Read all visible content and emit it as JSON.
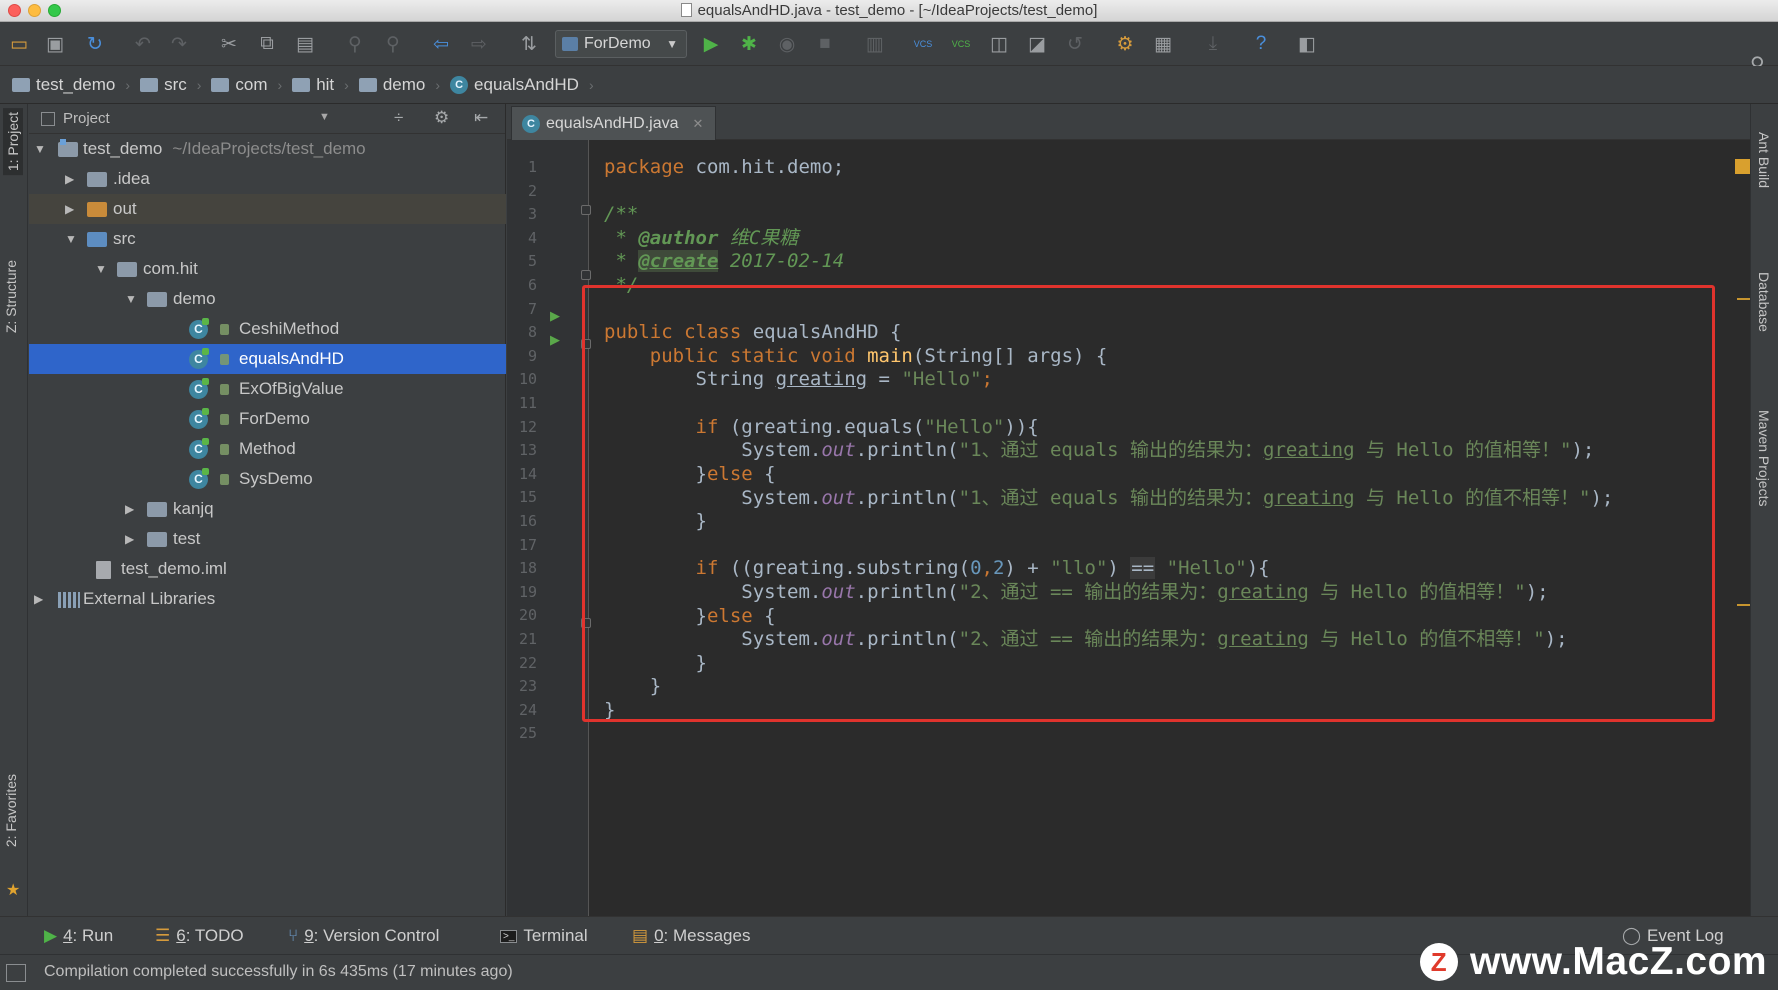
{
  "window": {
    "title": "equalsAndHD.java - test_demo - [~/IdeaProjects/test_demo]"
  },
  "toolbar": {
    "run_config": "ForDemo",
    "icons": [
      "open-folder-icon",
      "save-icon",
      "sync-icon",
      "undo-icon",
      "redo-icon",
      "cut-icon",
      "copy-icon",
      "paste-icon",
      "find-icon",
      "replace-icon",
      "back-icon",
      "forward-icon",
      "make-project-icon",
      "run-icon",
      "debug-icon",
      "coverage-icon",
      "stop-icon",
      "vcs-update-icon",
      "vcs-commit-icon",
      "vcs-history-icon",
      "project-structure-icon",
      "settings-icon",
      "help-icon",
      "search-icon"
    ],
    "vcs_label": "VCS",
    "help_label": "?"
  },
  "breadcrumb": [
    "test_demo",
    "src",
    "com",
    "hit",
    "demo",
    "equalsAndHD"
  ],
  "left_tabs": {
    "project": "1: Project",
    "structure": "Z: Structure",
    "favorites": "2: Favorites"
  },
  "right_tabs": {
    "ant": "Ant Build",
    "database": "Database",
    "maven": "Maven Projects"
  },
  "project_panel": {
    "title": "Project",
    "tree": [
      {
        "label": "test_demo",
        "path": "~/IdeaProjects/test_demo",
        "depth": 0,
        "kind": "module",
        "expanded": true
      },
      {
        "label": ".idea",
        "depth": 1,
        "kind": "folder",
        "expanded": false
      },
      {
        "label": "out",
        "depth": 1,
        "kind": "folder-orange",
        "expanded": false
      },
      {
        "label": "src",
        "depth": 1,
        "kind": "folder-blue",
        "expanded": true
      },
      {
        "label": "com.hit",
        "depth": 2,
        "kind": "package",
        "expanded": true
      },
      {
        "label": "demo",
        "depth": 3,
        "kind": "package",
        "expanded": true
      },
      {
        "label": "CeshiMethod",
        "depth": 4,
        "kind": "class"
      },
      {
        "label": "equalsAndHD",
        "depth": 4,
        "kind": "class",
        "selected": true
      },
      {
        "label": "ExOfBigValue",
        "depth": 4,
        "kind": "class"
      },
      {
        "label": "ForDemo",
        "depth": 4,
        "kind": "class"
      },
      {
        "label": "Method",
        "depth": 4,
        "kind": "class"
      },
      {
        "label": "SysDemo",
        "depth": 4,
        "kind": "class"
      },
      {
        "label": "kanjq",
        "depth": 3,
        "kind": "package",
        "expanded": false
      },
      {
        "label": "test",
        "depth": 3,
        "kind": "package",
        "expanded": false
      },
      {
        "label": "test_demo.iml",
        "depth": 2,
        "kind": "file"
      },
      {
        "label": "External Libraries",
        "depth": 0,
        "kind": "libs",
        "expanded": false
      }
    ]
  },
  "editor": {
    "tab_label": "equalsAndHD.java",
    "line_count": 25,
    "lines": {
      "l1_kw": "package",
      "l1_rest": " com.hit.demo;",
      "l3": "/**",
      "l4_star": " * ",
      "l4_tag": "@author",
      "l4_val": " 维C果糖",
      "l5_star": " * ",
      "l5_tag": "@create",
      "l5_val": " 2017-02-14",
      "l6": " */",
      "l8_kw": "public class",
      "l8_rest": " equalsAndHD {",
      "l9_kw": "    public static void",
      "l9_fn": " main",
      "l9_rest": "(String[] args) {",
      "l10_a": "        String ",
      "l10_var": "greating",
      "l10_b": " = ",
      "l10_str": "\"Hello\"",
      "l10_c": ";",
      "l12_kw": "        if",
      "l12_a": " (greating.equals(",
      "l12_str": "\"Hello\"",
      "l12_b": ")){",
      "l13_a": "            System.",
      "l13_out": "out",
      "l13_b": ".println(",
      "l13_s1": "\"1、通过 equals 输出的结果为：",
      "l13_var": "greating",
      "l13_s2": " 与 Hello 的值相等！\"",
      "l13_c": ");",
      "l14_a": "        }",
      "l14_kw": "else",
      "l14_b": " {",
      "l15_a": "            System.",
      "l15_out": "out",
      "l15_b": ".println(",
      "l15_s1": "\"1、通过 equals 输出的结果为：",
      "l15_var": "greating",
      "l15_s2": " 与 Hello 的值不相等！\"",
      "l15_c": ");",
      "l16": "        }",
      "l18_kw": "        if",
      "l18_a": " ((greating.substring(",
      "l18_n1": "0",
      "l18_comma": ",",
      "l18_n2": "2",
      "l18_b": ") + ",
      "l18_s1": "\"llo\"",
      "l18_c": ") ",
      "l18_eq": "==",
      "l18_d": " ",
      "l18_s2": "\"Hello\"",
      "l18_e": "){",
      "l19_a": "            System.",
      "l19_out": "out",
      "l19_b": ".println(",
      "l19_s1": "\"2、通过 == 输出的结果为：",
      "l19_var": "greating",
      "l19_s2": " 与 Hello 的值相等！\"",
      "l19_c": ");",
      "l20_a": "        }",
      "l20_kw": "else",
      "l20_b": " {",
      "l21_a": "            System.",
      "l21_out": "out",
      "l21_b": ".println(",
      "l21_s1": "\"2、通过 == 输出的结果为：",
      "l21_var": "greating",
      "l21_s2": " 与 Hello 的值不相等！\"",
      "l21_c": ");",
      "l22": "        }",
      "l23": "    }",
      "l24": "}"
    }
  },
  "bottom_tools": {
    "run": {
      "num": "4",
      "label": ": Run"
    },
    "todo": {
      "num": "6",
      "label": ": TODO"
    },
    "vcs": {
      "num": "9",
      "label": ": Version Control"
    },
    "terminal": {
      "label": "Terminal"
    },
    "messages": {
      "num": "0",
      "label": ": Messages"
    },
    "event_log": {
      "label": "Event Log"
    }
  },
  "status": {
    "message": "Compilation completed successfully in 6s 435ms (17 minutes ago)"
  },
  "watermark": {
    "logo_letter": "Z",
    "text": "www.MacZ.com"
  },
  "colors": {
    "highlight_box": "#e0332d",
    "selection": "#2f65ca",
    "keyword": "#cc7832",
    "string": "#6a8759"
  }
}
